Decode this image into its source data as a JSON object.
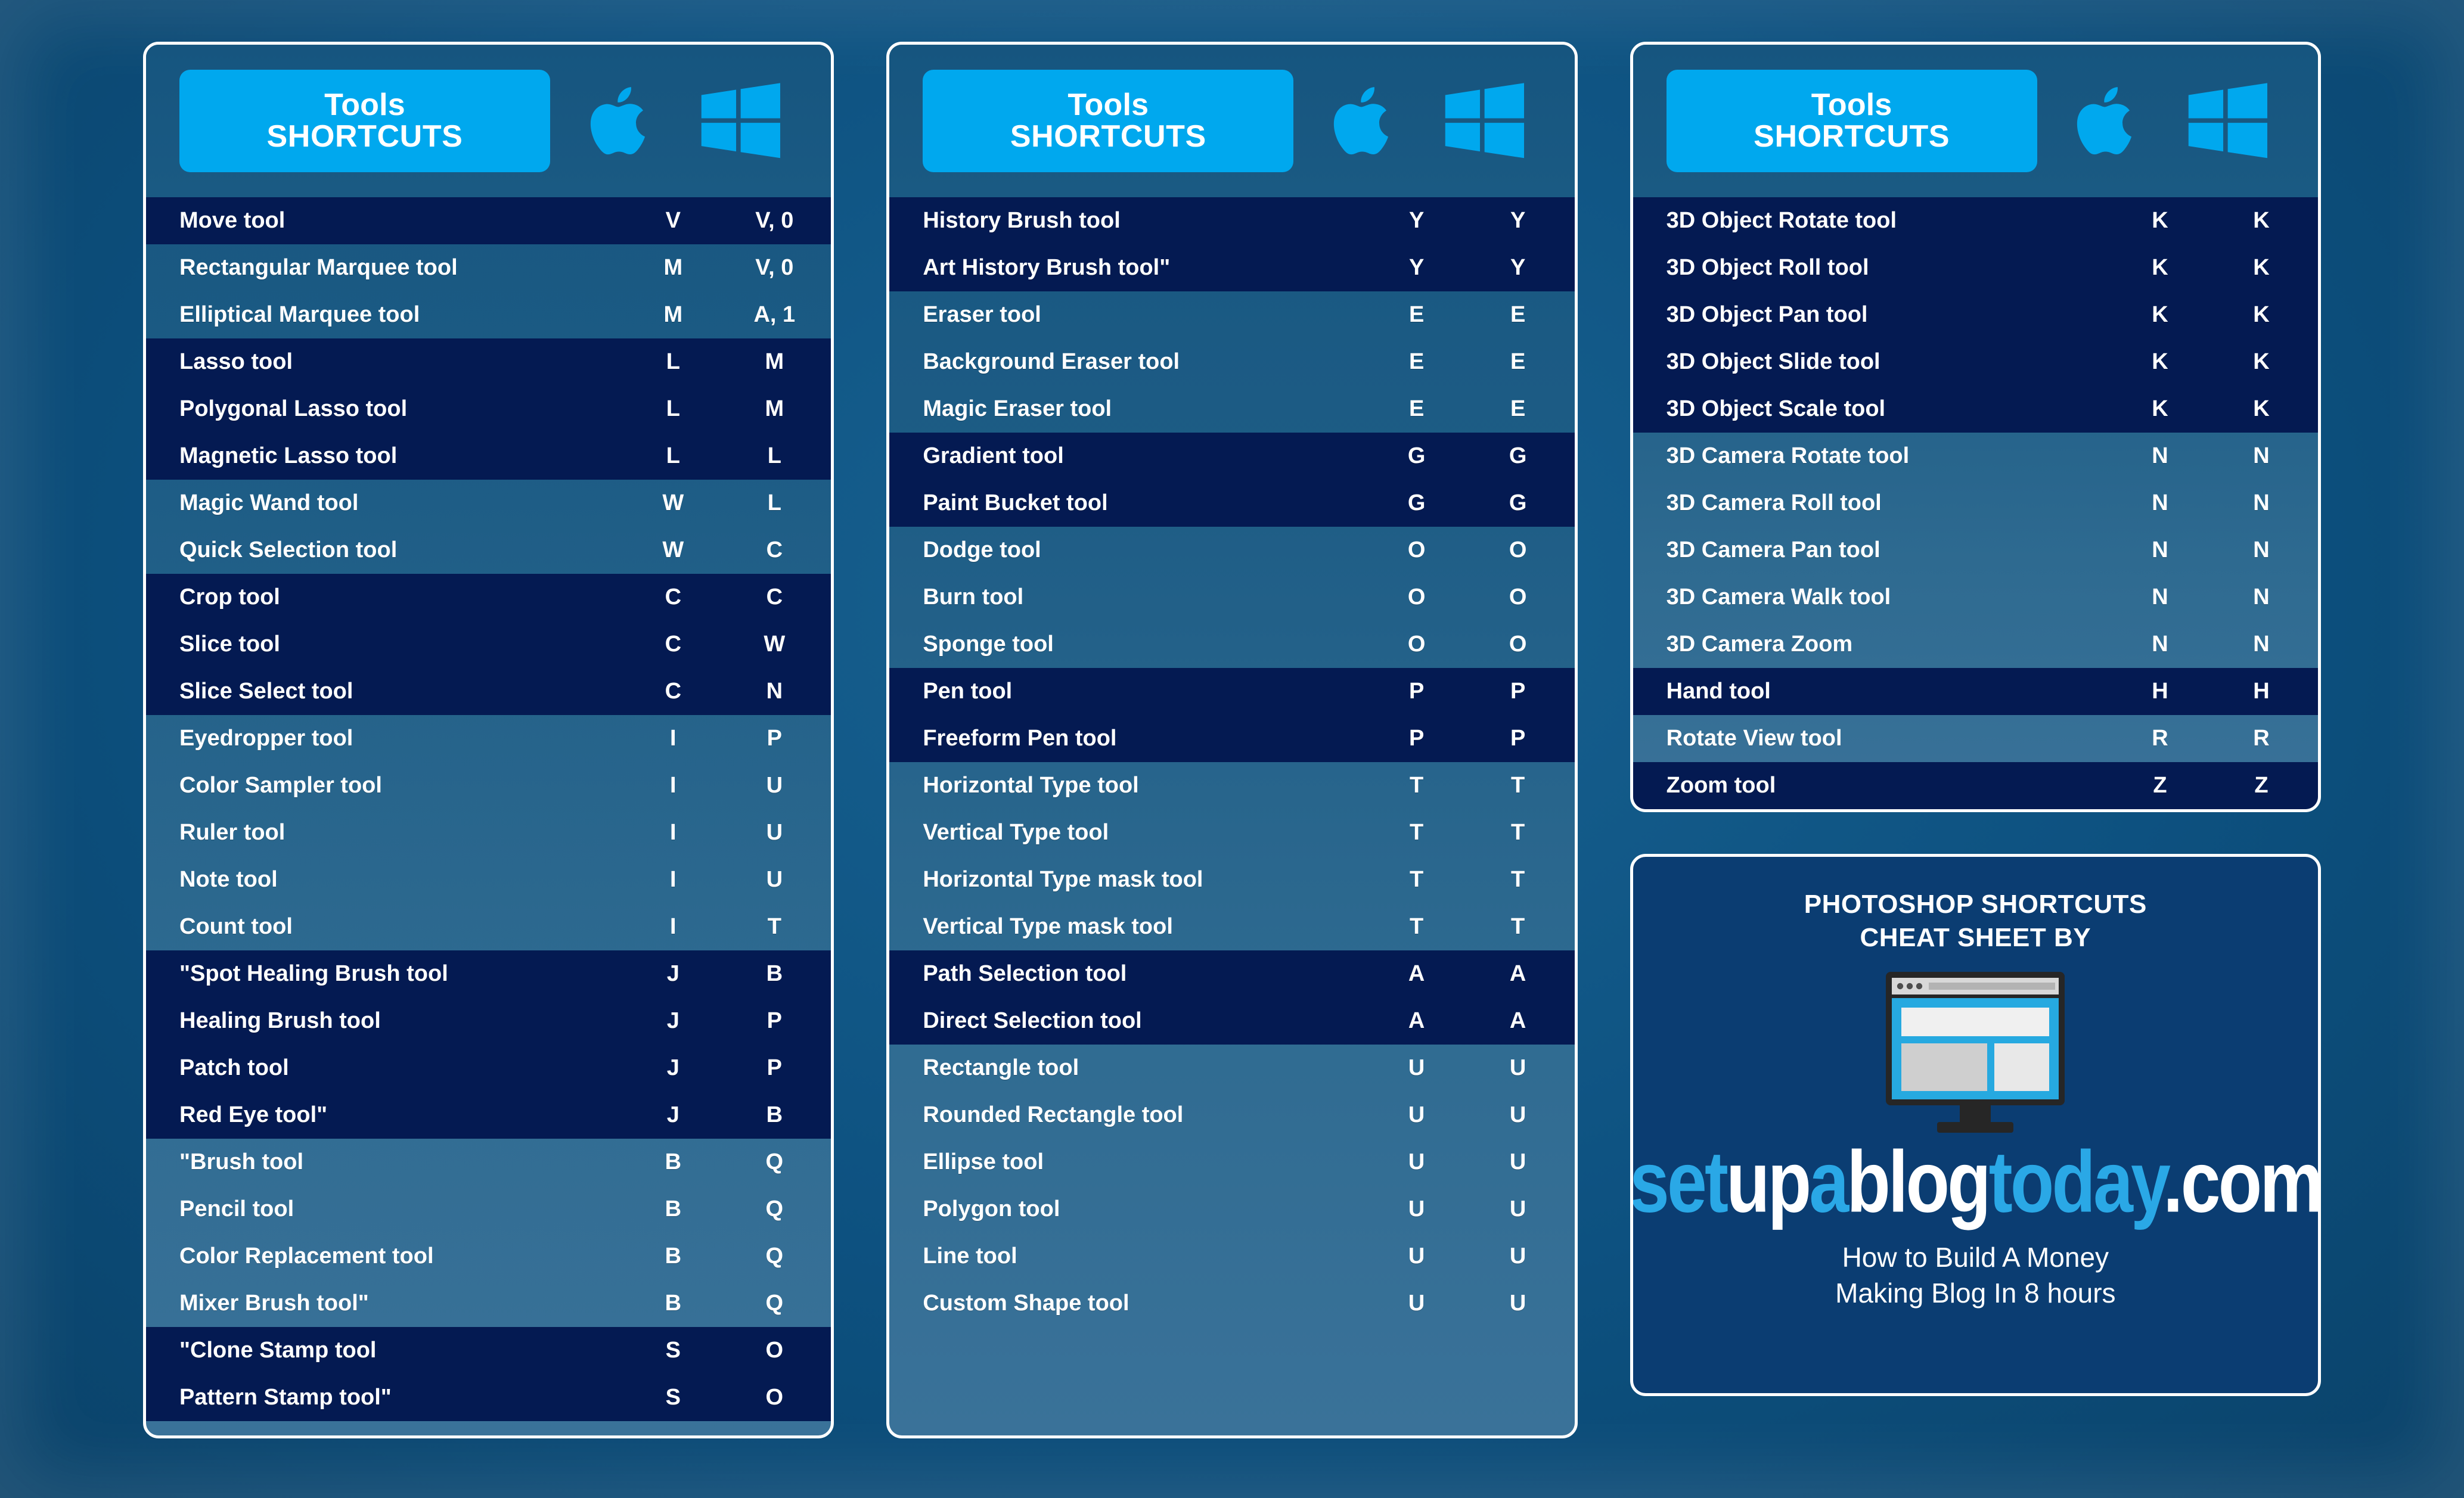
{
  "header": {
    "title_line1": "Tools",
    "title_line2": "SHORTCUTS",
    "apple_icon": "apple-icon",
    "windows_icon": "windows-icon"
  },
  "colors": {
    "accent": "#00a8ee",
    "row_dark": "#041a52",
    "row_light": "#1d5c85",
    "page_bg": "#0d5180",
    "brand_bg": "#0b3d72",
    "text": "#ffffff"
  },
  "columns": [
    {
      "groups": [
        {
          "shade": "dark",
          "rows": [
            {
              "name": "Move tool",
              "mac": "V",
              "win": "V, 0"
            }
          ]
        },
        {
          "shade": "light",
          "rows": [
            {
              "name": "Rectangular Marquee tool",
              "mac": "M",
              "win": "V, 0"
            },
            {
              "name": "Elliptical Marquee tool",
              "mac": "M",
              "win": "A, 1"
            }
          ]
        },
        {
          "shade": "dark",
          "rows": [
            {
              "name": "Lasso tool",
              "mac": "L",
              "win": "M"
            },
            {
              "name": "Polygonal Lasso tool",
              "mac": "L",
              "win": "M"
            },
            {
              "name": "Magnetic Lasso tool",
              "mac": "L",
              "win": "L"
            }
          ]
        },
        {
          "shade": "light",
          "rows": [
            {
              "name": "Magic Wand tool",
              "mac": "W",
              "win": "L"
            },
            {
              "name": "Quick Selection tool",
              "mac": "W",
              "win": "C"
            }
          ]
        },
        {
          "shade": "dark",
          "rows": [
            {
              "name": "Crop tool",
              "mac": "C",
              "win": "C"
            },
            {
              "name": "Slice tool",
              "mac": "C",
              "win": "W"
            },
            {
              "name": "Slice Select tool",
              "mac": "C",
              "win": "N"
            }
          ]
        },
        {
          "shade": "light",
          "rows": [
            {
              "name": "Eyedropper tool",
              "mac": "I",
              "win": "P"
            },
            {
              "name": "Color Sampler tool",
              "mac": "I",
              "win": "U"
            },
            {
              "name": "Ruler tool",
              "mac": "I",
              "win": "U"
            },
            {
              "name": "Note tool",
              "mac": "I",
              "win": "U"
            },
            {
              "name": "Count tool",
              "mac": "I",
              "win": "T"
            }
          ]
        },
        {
          "shade": "dark",
          "rows": [
            {
              "name": "\"Spot Healing Brush tool",
              "mac": "J",
              "win": "B"
            },
            {
              "name": "Healing Brush tool",
              "mac": "J",
              "win": "P"
            },
            {
              "name": "Patch tool",
              "mac": "J",
              "win": "P"
            },
            {
              "name": "Red Eye tool\"",
              "mac": "J",
              "win": "B"
            }
          ]
        },
        {
          "shade": "light",
          "rows": [
            {
              "name": "\"Brush tool",
              "mac": "B",
              "win": "Q"
            },
            {
              "name": "Pencil tool",
              "mac": "B",
              "win": "Q"
            },
            {
              "name": "Color Replacement tool",
              "mac": "B",
              "win": "Q"
            },
            {
              "name": "Mixer Brush tool\"",
              "mac": "B",
              "win": "Q"
            }
          ]
        },
        {
          "shade": "dark",
          "rows": [
            {
              "name": "\"Clone Stamp tool",
              "mac": "S",
              "win": "O"
            },
            {
              "name": "Pattern Stamp tool\"",
              "mac": "S",
              "win": "O"
            }
          ]
        }
      ]
    },
    {
      "groups": [
        {
          "shade": "dark",
          "rows": [
            {
              "name": "History Brush tool",
              "mac": "Y",
              "win": "Y"
            },
            {
              "name": "Art History Brush tool\"",
              "mac": "Y",
              "win": "Y"
            }
          ]
        },
        {
          "shade": "light",
          "rows": [
            {
              "name": "Eraser tool",
              "mac": "E",
              "win": "E"
            },
            {
              "name": "Background Eraser tool",
              "mac": "E",
              "win": "E"
            },
            {
              "name": "Magic Eraser tool",
              "mac": "E",
              "win": "E"
            }
          ]
        },
        {
          "shade": "dark",
          "rows": [
            {
              "name": "Gradient tool",
              "mac": "G",
              "win": "G"
            },
            {
              "name": "Paint Bucket tool",
              "mac": "G",
              "win": "G"
            }
          ]
        },
        {
          "shade": "light",
          "rows": [
            {
              "name": "Dodge tool",
              "mac": "O",
              "win": "O"
            },
            {
              "name": "Burn tool",
              "mac": "O",
              "win": "O"
            },
            {
              "name": "Sponge tool",
              "mac": "O",
              "win": "O"
            }
          ]
        },
        {
          "shade": "dark",
          "rows": [
            {
              "name": "Pen tool",
              "mac": "P",
              "win": "P"
            },
            {
              "name": "Freeform Pen tool",
              "mac": "P",
              "win": "P"
            }
          ]
        },
        {
          "shade": "light",
          "rows": [
            {
              "name": "Horizontal Type tool",
              "mac": "T",
              "win": "T"
            },
            {
              "name": "Vertical Type tool",
              "mac": "T",
              "win": "T"
            },
            {
              "name": "Horizontal Type mask tool",
              "mac": "T",
              "win": "T"
            },
            {
              "name": "Vertical Type mask tool",
              "mac": "T",
              "win": "T"
            }
          ]
        },
        {
          "shade": "dark",
          "rows": [
            {
              "name": "Path Selection tool",
              "mac": "A",
              "win": "A"
            },
            {
              "name": "Direct Selection tool",
              "mac": "A",
              "win": "A"
            }
          ]
        },
        {
          "shade": "light",
          "rows": [
            {
              "name": "Rectangle tool",
              "mac": "U",
              "win": "U"
            },
            {
              "name": "Rounded Rectangle tool",
              "mac": "U",
              "win": "U"
            },
            {
              "name": "Ellipse tool",
              "mac": "U",
              "win": "U"
            },
            {
              "name": "Polygon tool",
              "mac": "U",
              "win": "U"
            },
            {
              "name": "Line tool",
              "mac": "U",
              "win": "U"
            },
            {
              "name": "Custom Shape tool",
              "mac": "U",
              "win": "U"
            }
          ]
        }
      ]
    },
    {
      "groups": [
        {
          "shade": "dark",
          "rows": [
            {
              "name": "3D Object Rotate tool",
              "mac": "K",
              "win": "K"
            },
            {
              "name": "3D Object Roll tool",
              "mac": "K",
              "win": "K"
            },
            {
              "name": "3D Object Pan tool",
              "mac": "K",
              "win": "K"
            },
            {
              "name": "3D Object Slide tool",
              "mac": "K",
              "win": "K"
            },
            {
              "name": "3D Object Scale tool",
              "mac": "K",
              "win": "K"
            }
          ]
        },
        {
          "shade": "light",
          "rows": [
            {
              "name": "3D Camera Rotate tool",
              "mac": "N",
              "win": "N"
            },
            {
              "name": "3D Camera Roll tool",
              "mac": "N",
              "win": "N"
            },
            {
              "name": "3D Camera Pan tool",
              "mac": "N",
              "win": "N"
            },
            {
              "name": "3D Camera Walk tool",
              "mac": "N",
              "win": "N"
            },
            {
              "name": "3D Camera Zoom",
              "mac": "N",
              "win": "N"
            }
          ]
        },
        {
          "shade": "dark",
          "rows": [
            {
              "name": "Hand tool",
              "mac": "H",
              "win": "H"
            }
          ]
        },
        {
          "shade": "light",
          "rows": [
            {
              "name": "Rotate View tool",
              "mac": "R",
              "win": "R"
            }
          ]
        },
        {
          "shade": "dark",
          "rows": [
            {
              "name": "Zoom tool",
              "mac": "Z",
              "win": "Z"
            }
          ]
        }
      ]
    }
  ],
  "brand": {
    "title_line1": "PHOTOSHOP SHORTCUTS",
    "title_line2": "CHEAT SHEET BY",
    "monitor_icon": "monitor-icon",
    "logo_parts": [
      {
        "text": "set",
        "color": "blue"
      },
      {
        "text": "up",
        "color": "white"
      },
      {
        "text": "a",
        "color": "blue"
      },
      {
        "text": "blog",
        "color": "white"
      },
      {
        "text": "today",
        "color": "blue"
      },
      {
        "text": ".com",
        "color": "white"
      }
    ],
    "tagline_line1": "How to Build A Money",
    "tagline_line2": "Making Blog In 8 hours"
  }
}
